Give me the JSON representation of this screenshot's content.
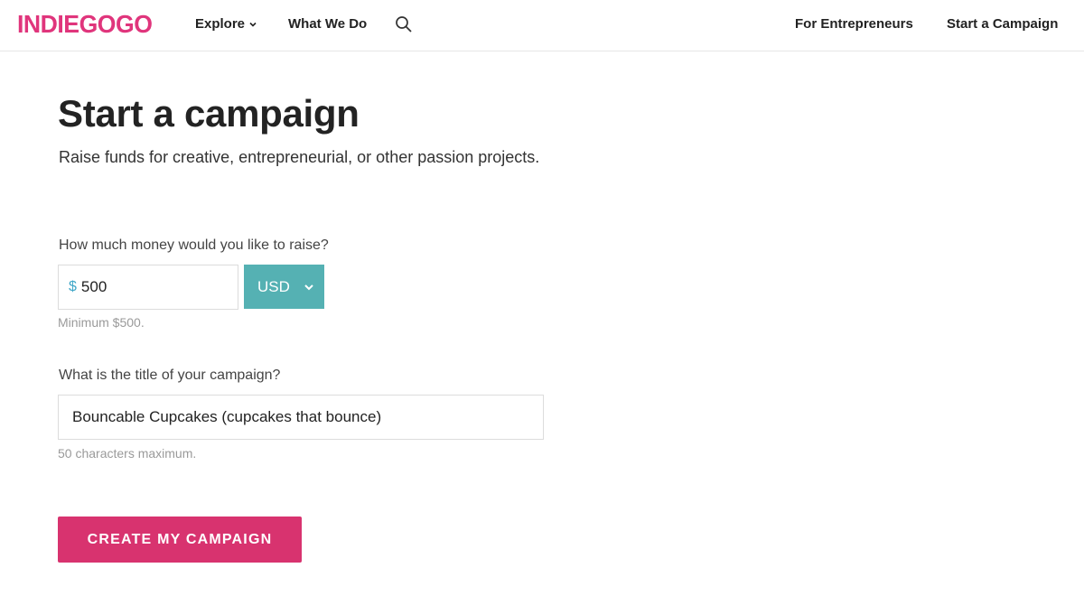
{
  "header": {
    "logo": "INDIEGOGO",
    "nav": {
      "explore": "Explore",
      "what_we_do": "What We Do",
      "search_icon": "search-icon",
      "for_entrepreneurs": "For Entrepreneurs",
      "start_campaign": "Start a Campaign"
    }
  },
  "main": {
    "title": "Start a campaign",
    "subtitle": "Raise funds for creative, entrepreneurial, or other passion projects.",
    "money": {
      "label": "How much money would you like to raise?",
      "currency_symbol": "$",
      "value": "500",
      "currency": "USD",
      "helper": "Minimum $500."
    },
    "campaign_title": {
      "label": "What is the title of your campaign?",
      "value": "Bouncable Cupcakes (cupcakes that bounce)",
      "helper": "50 characters maximum."
    },
    "create_button": "CREATE MY CAMPAIGN"
  },
  "colors": {
    "brand": "#e0357c",
    "button": "#d8336f",
    "currency_select": "#55b1b3",
    "currency_symbol": "#3fa6c7"
  }
}
